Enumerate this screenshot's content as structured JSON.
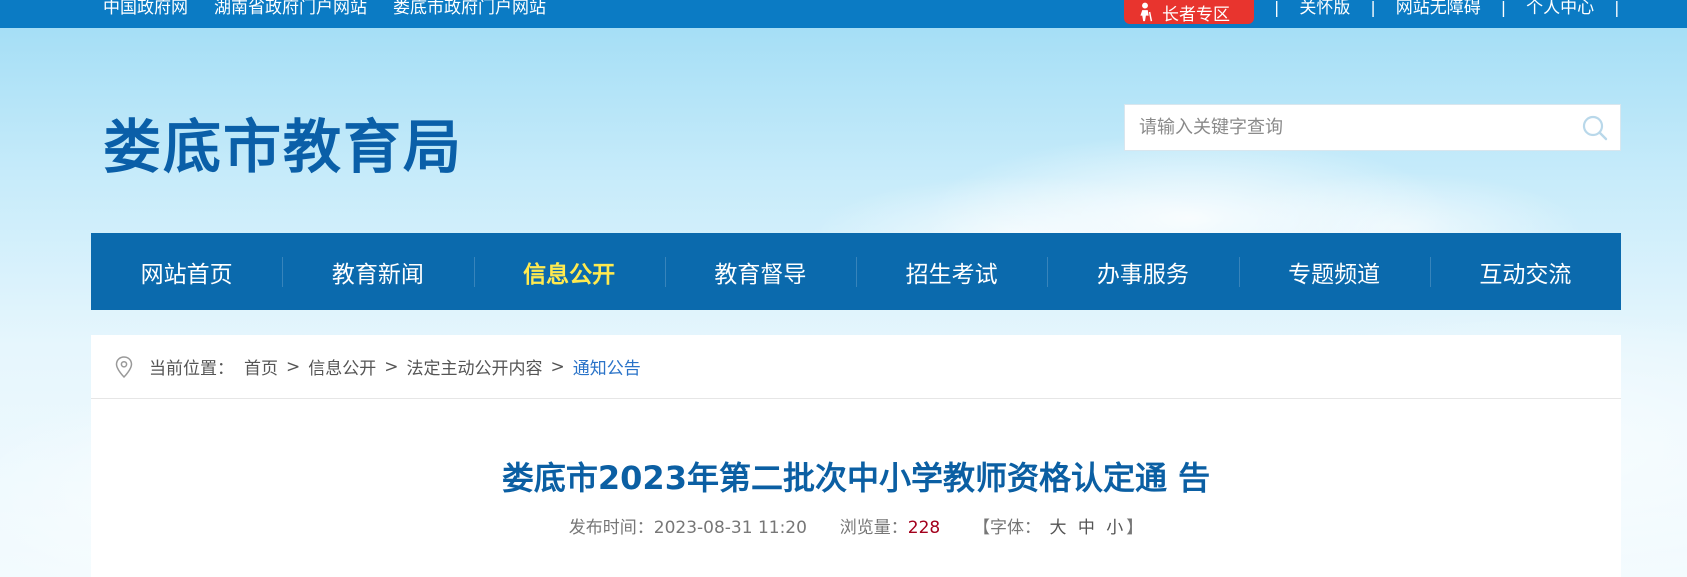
{
  "topbar": {
    "links": [
      "中国政府网",
      "湖南省政府门户网站",
      "娄底市政府门户网站"
    ],
    "elder_label": "长者专区",
    "right_links": [
      "关怀版",
      "网站无障碍",
      "个人中心"
    ],
    "separator": "|"
  },
  "header": {
    "site_title": "娄底市教育局",
    "search_placeholder": "请输入关键字查询",
    "search_icon": "search-icon"
  },
  "nav": {
    "items": [
      "网站首页",
      "教育新闻",
      "信息公开",
      "教育督导",
      "招生考试",
      "办事服务",
      "专题频道",
      "互动交流"
    ],
    "active_index": 2
  },
  "breadcrumb": {
    "prefix": "当前位置：",
    "items": [
      "首页",
      "信息公开",
      "法定主动公开内容"
    ],
    "current": "通知公告",
    "separator": ">"
  },
  "article": {
    "title": "娄底市2023年第二批次中小学教师资格认定通 告",
    "publish_label": "发布时间：",
    "publish_time": "2023-08-31 11:20",
    "views_label": "浏览量：",
    "views": "228",
    "font_label": "【字体：",
    "font_sizes": [
      "大",
      "中",
      "小"
    ],
    "font_close": "】"
  },
  "colors": {
    "topbar_bg": "#0b7bc4",
    "nav_bg": "#0b6aad",
    "nav_active": "#ffea4f",
    "title_blue": "#0b5fa3",
    "elder_red": "#e8342e",
    "views_red": "#a3001c"
  }
}
